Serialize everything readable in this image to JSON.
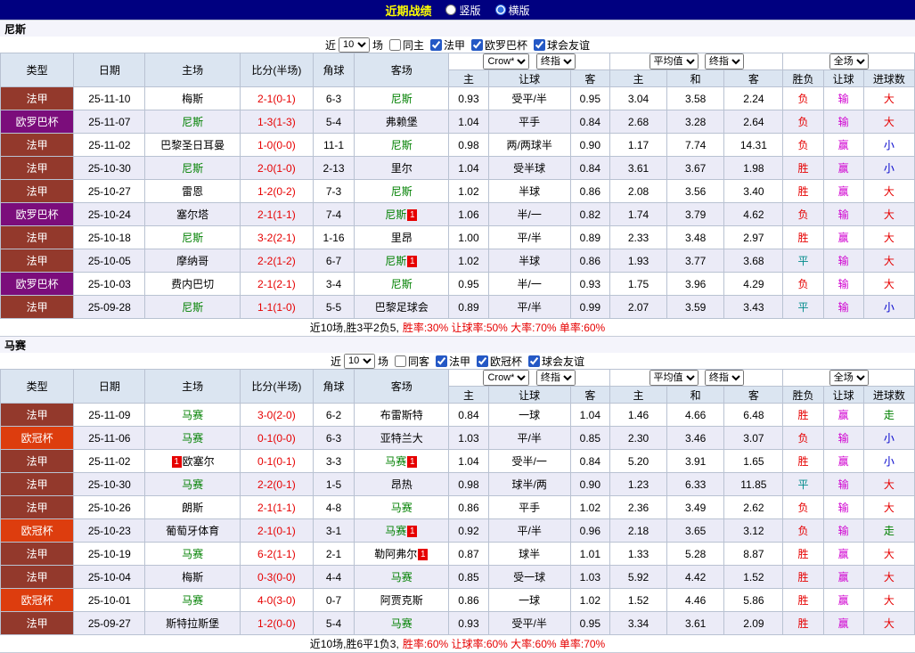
{
  "topbar": {
    "title": "近期战绩",
    "radios": [
      {
        "label": "竖版",
        "selected": false
      },
      {
        "label": "横版",
        "selected": true
      }
    ]
  },
  "table_headers": [
    "类型",
    "日期",
    "主场",
    "比分(半场)",
    "角球",
    "客场",
    "主",
    "让球",
    "客",
    "主",
    "和",
    "客",
    "胜负",
    "让球",
    "进球数"
  ],
  "league_colors": {
    "法甲": "#93392c",
    "欧罗巴杯": "#7b0d7b",
    "欧冠杯": "#dd3d0e"
  },
  "result_colors": {
    "胜": "#e60000",
    "负": "#e60000",
    "平": "#008b8b",
    "赢": "#d000d0",
    "输": "#d000d0",
    "大": "#e60000",
    "小": "#0000cc",
    "走": "#008000"
  },
  "score_color": "#e60000",
  "sections": [
    {
      "team": "尼斯",
      "filter": {
        "prefix": "近",
        "count": "10",
        "suffix": "场",
        "checkboxes": [
          {
            "label": "同主",
            "checked": false
          },
          {
            "label": "法甲",
            "checked": true
          },
          {
            "label": "欧罗巴杯",
            "checked": true
          },
          {
            "label": "球会友谊",
            "checked": true
          }
        ]
      },
      "selects": {
        "bookmaker": "Crow*",
        "handicap_kind": "终指",
        "average": "平均值",
        "average_kind": "终指",
        "scope": "全场"
      },
      "rows": [
        {
          "league": "法甲",
          "date": "25-11-10",
          "home": {
            "name": "梅斯",
            "featured": false,
            "badge": null
          },
          "score": "2-1(0-1)",
          "corners": "6-3",
          "away": {
            "name": "尼斯",
            "featured": true,
            "badge": null
          },
          "h_odds": "0.93",
          "handicap": "受平/半",
          "a_odds": "0.95",
          "avg_h": "3.04",
          "avg_d": "3.58",
          "avg_a": "2.24",
          "spf": "负",
          "rq": "输",
          "dx": "大"
        },
        {
          "league": "欧罗巴杯",
          "date": "25-11-07",
          "home": {
            "name": "尼斯",
            "featured": true,
            "badge": null
          },
          "score": "1-3(1-3)",
          "corners": "5-4",
          "away": {
            "name": "弗赖堡",
            "featured": false,
            "badge": null
          },
          "h_odds": "1.04",
          "handicap": "平手",
          "a_odds": "0.84",
          "avg_h": "2.68",
          "avg_d": "3.28",
          "avg_a": "2.64",
          "spf": "负",
          "rq": "输",
          "dx": "大"
        },
        {
          "league": "法甲",
          "date": "25-11-02",
          "home": {
            "name": "巴黎圣日耳曼",
            "featured": false,
            "badge": null
          },
          "score": "1-0(0-0)",
          "corners": "11-1",
          "away": {
            "name": "尼斯",
            "featured": true,
            "badge": null
          },
          "h_odds": "0.98",
          "handicap": "两/两球半",
          "a_odds": "0.90",
          "avg_h": "1.17",
          "avg_d": "7.74",
          "avg_a": "14.31",
          "spf": "负",
          "rq": "赢",
          "dx": "小"
        },
        {
          "league": "法甲",
          "date": "25-10-30",
          "home": {
            "name": "尼斯",
            "featured": true,
            "badge": null
          },
          "score": "2-0(1-0)",
          "corners": "2-13",
          "away": {
            "name": "里尔",
            "featured": false,
            "badge": null
          },
          "h_odds": "1.04",
          "handicap": "受半球",
          "a_odds": "0.84",
          "avg_h": "3.61",
          "avg_d": "3.67",
          "avg_a": "1.98",
          "spf": "胜",
          "rq": "赢",
          "dx": "小"
        },
        {
          "league": "法甲",
          "date": "25-10-27",
          "home": {
            "name": "雷恩",
            "featured": false,
            "badge": null
          },
          "score": "1-2(0-2)",
          "corners": "7-3",
          "away": {
            "name": "尼斯",
            "featured": true,
            "badge": null
          },
          "h_odds": "1.02",
          "handicap": "半球",
          "a_odds": "0.86",
          "avg_h": "2.08",
          "avg_d": "3.56",
          "avg_a": "3.40",
          "spf": "胜",
          "rq": "赢",
          "dx": "大"
        },
        {
          "league": "欧罗巴杯",
          "date": "25-10-24",
          "home": {
            "name": "塞尔塔",
            "featured": false,
            "badge": null
          },
          "score": "2-1(1-1)",
          "corners": "7-4",
          "away": {
            "name": "尼斯",
            "featured": true,
            "badge": "after"
          },
          "h_odds": "1.06",
          "handicap": "半/一",
          "a_odds": "0.82",
          "avg_h": "1.74",
          "avg_d": "3.79",
          "avg_a": "4.62",
          "spf": "负",
          "rq": "输",
          "dx": "大"
        },
        {
          "league": "法甲",
          "date": "25-10-18",
          "home": {
            "name": "尼斯",
            "featured": true,
            "badge": null
          },
          "score": "3-2(2-1)",
          "corners": "1-16",
          "away": {
            "name": "里昂",
            "featured": false,
            "badge": null
          },
          "h_odds": "1.00",
          "handicap": "平/半",
          "a_odds": "0.89",
          "avg_h": "2.33",
          "avg_d": "3.48",
          "avg_a": "2.97",
          "spf": "胜",
          "rq": "赢",
          "dx": "大"
        },
        {
          "league": "法甲",
          "date": "25-10-05",
          "home": {
            "name": "摩纳哥",
            "featured": false,
            "badge": null
          },
          "score": "2-2(1-2)",
          "corners": "6-7",
          "away": {
            "name": "尼斯",
            "featured": true,
            "badge": "after"
          },
          "h_odds": "1.02",
          "handicap": "半球",
          "a_odds": "0.86",
          "avg_h": "1.93",
          "avg_d": "3.77",
          "avg_a": "3.68",
          "spf": "平",
          "rq": "输",
          "dx": "大"
        },
        {
          "league": "欧罗巴杯",
          "date": "25-10-03",
          "home": {
            "name": "费内巴切",
            "featured": false,
            "badge": null
          },
          "score": "2-1(2-1)",
          "corners": "3-4",
          "away": {
            "name": "尼斯",
            "featured": true,
            "badge": null
          },
          "h_odds": "0.95",
          "handicap": "半/一",
          "a_odds": "0.93",
          "avg_h": "1.75",
          "avg_d": "3.96",
          "avg_a": "4.29",
          "spf": "负",
          "rq": "输",
          "dx": "大"
        },
        {
          "league": "法甲",
          "date": "25-09-28",
          "home": {
            "name": "尼斯",
            "featured": true,
            "badge": null
          },
          "score": "1-1(1-0)",
          "corners": "5-5",
          "away": {
            "name": "巴黎足球会",
            "featured": false,
            "badge": null
          },
          "h_odds": "0.89",
          "handicap": "平/半",
          "a_odds": "0.99",
          "avg_h": "2.07",
          "avg_d": "3.59",
          "avg_a": "3.43",
          "spf": "平",
          "rq": "输",
          "dx": "小"
        }
      ],
      "summary_prefix": "近10场,胜3平2负5,",
      "summary_rates": "胜率:30% 让球率:50% 大率:70% 单率:60%"
    },
    {
      "team": "马赛",
      "filter": {
        "prefix": "近",
        "count": "10",
        "suffix": "场",
        "checkboxes": [
          {
            "label": "同客",
            "checked": false
          },
          {
            "label": "法甲",
            "checked": true
          },
          {
            "label": "欧冠杯",
            "checked": true
          },
          {
            "label": "球会友谊",
            "checked": true
          }
        ]
      },
      "selects": {
        "bookmaker": "Crow*",
        "handicap_kind": "终指",
        "average": "平均值",
        "average_kind": "终指",
        "scope": "全场"
      },
      "rows": [
        {
          "league": "法甲",
          "date": "25-11-09",
          "home": {
            "name": "马赛",
            "featured": true,
            "badge": null
          },
          "score": "3-0(2-0)",
          "corners": "6-2",
          "away": {
            "name": "布雷斯特",
            "featured": false,
            "badge": null
          },
          "h_odds": "0.84",
          "handicap": "一球",
          "a_odds": "1.04",
          "avg_h": "1.46",
          "avg_d": "4.66",
          "avg_a": "6.48",
          "spf": "胜",
          "rq": "赢",
          "dx": "走"
        },
        {
          "league": "欧冠杯",
          "date": "25-11-06",
          "home": {
            "name": "马赛",
            "featured": true,
            "badge": null
          },
          "score": "0-1(0-0)",
          "corners": "6-3",
          "away": {
            "name": "亚特兰大",
            "featured": false,
            "badge": null
          },
          "h_odds": "1.03",
          "handicap": "平/半",
          "a_odds": "0.85",
          "avg_h": "2.30",
          "avg_d": "3.46",
          "avg_a": "3.07",
          "spf": "负",
          "rq": "输",
          "dx": "小"
        },
        {
          "league": "法甲",
          "date": "25-11-02",
          "home": {
            "name": "欧塞尔",
            "featured": false,
            "badge": "before"
          },
          "score": "0-1(0-1)",
          "corners": "3-3",
          "away": {
            "name": "马赛",
            "featured": true,
            "badge": "after"
          },
          "h_odds": "1.04",
          "handicap": "受半/一",
          "a_odds": "0.84",
          "avg_h": "5.20",
          "avg_d": "3.91",
          "avg_a": "1.65",
          "spf": "胜",
          "rq": "赢",
          "dx": "小"
        },
        {
          "league": "法甲",
          "date": "25-10-30",
          "home": {
            "name": "马赛",
            "featured": true,
            "badge": null
          },
          "score": "2-2(0-1)",
          "corners": "1-5",
          "away": {
            "name": "昂热",
            "featured": false,
            "badge": null
          },
          "h_odds": "0.98",
          "handicap": "球半/两",
          "a_odds": "0.90",
          "avg_h": "1.23",
          "avg_d": "6.33",
          "avg_a": "11.85",
          "spf": "平",
          "rq": "输",
          "dx": "大"
        },
        {
          "league": "法甲",
          "date": "25-10-26",
          "home": {
            "name": "朗斯",
            "featured": false,
            "badge": null
          },
          "score": "2-1(1-1)",
          "corners": "4-8",
          "away": {
            "name": "马赛",
            "featured": true,
            "badge": null
          },
          "h_odds": "0.86",
          "handicap": "平手",
          "a_odds": "1.02",
          "avg_h": "2.36",
          "avg_d": "3.49",
          "avg_a": "2.62",
          "spf": "负",
          "rq": "输",
          "dx": "大"
        },
        {
          "league": "欧冠杯",
          "date": "25-10-23",
          "home": {
            "name": "葡萄牙体育",
            "featured": false,
            "badge": null
          },
          "score": "2-1(0-1)",
          "corners": "3-1",
          "away": {
            "name": "马赛",
            "featured": true,
            "badge": "after"
          },
          "h_odds": "0.92",
          "handicap": "平/半",
          "a_odds": "0.96",
          "avg_h": "2.18",
          "avg_d": "3.65",
          "avg_a": "3.12",
          "spf": "负",
          "rq": "输",
          "dx": "走"
        },
        {
          "league": "法甲",
          "date": "25-10-19",
          "home": {
            "name": "马赛",
            "featured": true,
            "badge": null
          },
          "score": "6-2(1-1)",
          "corners": "2-1",
          "away": {
            "name": "勒阿弗尔",
            "featured": false,
            "badge": "after"
          },
          "h_odds": "0.87",
          "handicap": "球半",
          "a_odds": "1.01",
          "avg_h": "1.33",
          "avg_d": "5.28",
          "avg_a": "8.87",
          "spf": "胜",
          "rq": "赢",
          "dx": "大"
        },
        {
          "league": "法甲",
          "date": "25-10-04",
          "home": {
            "name": "梅斯",
            "featured": false,
            "badge": null
          },
          "score": "0-3(0-0)",
          "corners": "4-4",
          "away": {
            "name": "马赛",
            "featured": true,
            "badge": null
          },
          "h_odds": "0.85",
          "handicap": "受一球",
          "a_odds": "1.03",
          "avg_h": "5.92",
          "avg_d": "4.42",
          "avg_a": "1.52",
          "spf": "胜",
          "rq": "赢",
          "dx": "大"
        },
        {
          "league": "欧冠杯",
          "date": "25-10-01",
          "home": {
            "name": "马赛",
            "featured": true,
            "badge": null
          },
          "score": "4-0(3-0)",
          "corners": "0-7",
          "away": {
            "name": "阿贾克斯",
            "featured": false,
            "badge": null
          },
          "h_odds": "0.86",
          "handicap": "一球",
          "a_odds": "1.02",
          "avg_h": "1.52",
          "avg_d": "4.46",
          "avg_a": "5.86",
          "spf": "胜",
          "rq": "赢",
          "dx": "大"
        },
        {
          "league": "法甲",
          "date": "25-09-27",
          "home": {
            "name": "斯特拉斯堡",
            "featured": false,
            "badge": null
          },
          "score": "1-2(0-0)",
          "corners": "5-4",
          "away": {
            "name": "马赛",
            "featured": true,
            "badge": null
          },
          "h_odds": "0.93",
          "handicap": "受平/半",
          "a_odds": "0.95",
          "avg_h": "3.34",
          "avg_d": "3.61",
          "avg_a": "2.09",
          "spf": "胜",
          "rq": "赢",
          "dx": "大"
        }
      ],
      "summary_prefix": "近10场,胜6平1负3,",
      "summary_rates": "胜率:60% 让球率:60% 大率:60% 单率:70%"
    }
  ]
}
